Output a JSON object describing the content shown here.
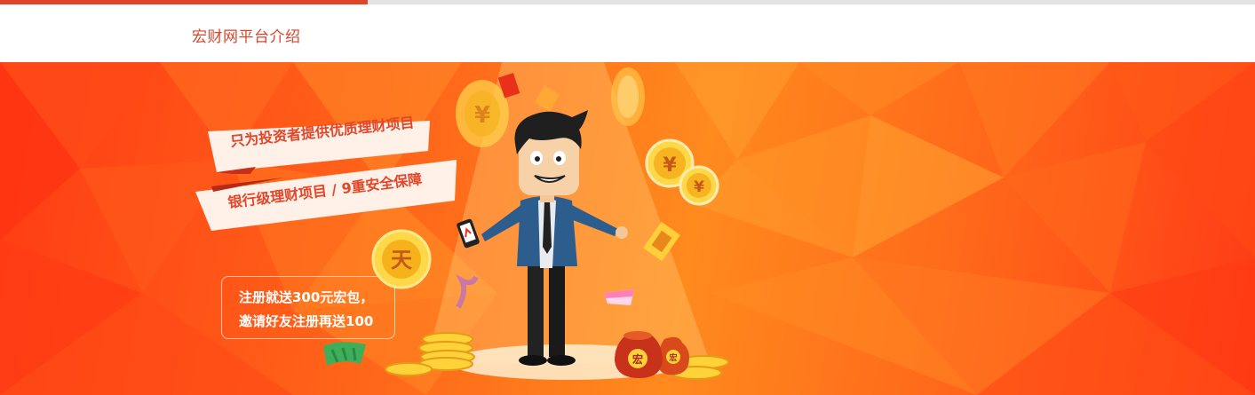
{
  "progress": {
    "fraction": 0.293,
    "fill_color": "#e0452a",
    "track_color": "#e3e3e3"
  },
  "header": {
    "title": "宏财网平台介绍",
    "title_color": "#d9452b"
  },
  "banner": {
    "ribbons": [
      "只为投资者提供优质理财项目",
      "银行级理财项目 / 9重安全保障"
    ],
    "promo": {
      "line1": "注册就送300元宏包，",
      "line2": "邀请好友注册再送100"
    },
    "coin_glyphs": {
      "yuan": "¥",
      "brand": "宏",
      "badge": "天"
    },
    "icons": [
      "mascot-businessman-icon",
      "gold-coin-icon",
      "money-bag-icon",
      "red-envelope-icon",
      "smartphone-icon"
    ],
    "colors": {
      "banner_red": "#ff3b14",
      "banner_orange": "#ff8a1e",
      "ribbon_text": "#e2472a"
    }
  }
}
